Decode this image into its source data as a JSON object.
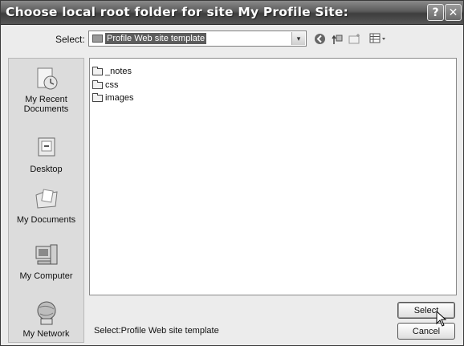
{
  "window": {
    "title": "Choose local root folder for site My Profile Site:",
    "help_label": "?",
    "close_label": "✕"
  },
  "toolbar": {
    "select_label": "Select:",
    "current_folder": "Profile Web site template",
    "dropdown_arrow": "▾",
    "icons": [
      "back-icon",
      "up-folder-icon",
      "new-folder-icon",
      "views-menu-icon"
    ]
  },
  "places": [
    {
      "label": "My Recent Documents",
      "icon": "recent-documents-icon"
    },
    {
      "label": "Desktop",
      "icon": "desktop-icon"
    },
    {
      "label": "My Documents",
      "icon": "my-documents-icon"
    },
    {
      "label": "My Computer",
      "icon": "my-computer-icon"
    },
    {
      "label": "My Network",
      "icon": "my-network-icon"
    }
  ],
  "files": [
    {
      "name": "_notes"
    },
    {
      "name": "css"
    },
    {
      "name": "images"
    }
  ],
  "footer": {
    "status_text": "Select:Profile Web site template",
    "select_button": "Select",
    "cancel_button": "Cancel"
  }
}
